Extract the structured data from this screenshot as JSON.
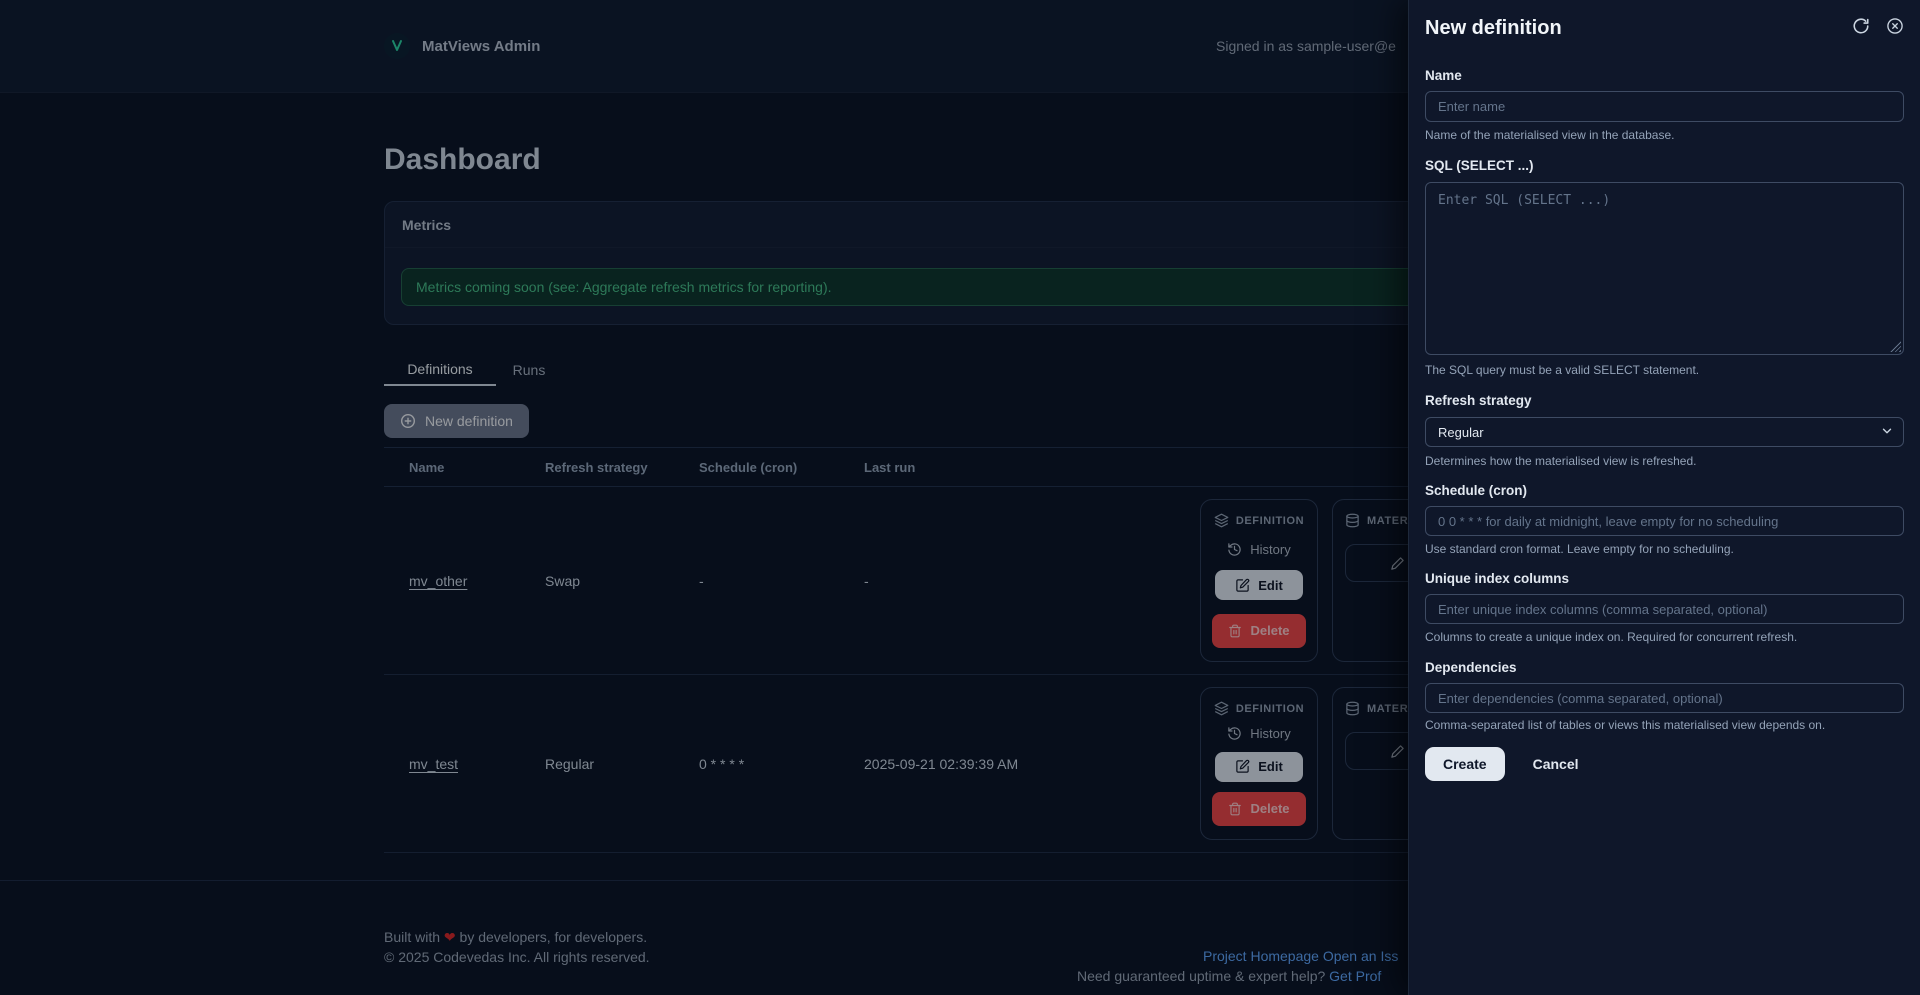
{
  "colors": {
    "accent_green": "#48be85",
    "link_blue": "#60a5fa",
    "danger_red": "#ef4444",
    "logo_teal": "#2dd4a0"
  },
  "header": {
    "app_title": "MatViews Admin",
    "signed_in": "Signed in as sample-user@e"
  },
  "page": {
    "title": "Dashboard"
  },
  "metrics": {
    "title": "Metrics",
    "notice": "Metrics coming soon (see: Aggregate refresh metrics for reporting)."
  },
  "tabs": {
    "definitions": "Definitions",
    "runs": "Runs"
  },
  "toolbar": {
    "new_definition": "New definition"
  },
  "table": {
    "columns": {
      "name": "Name",
      "refresh_strategy": "Refresh strategy",
      "schedule": "Schedule (cron)",
      "last_run": "Last run"
    },
    "rows": [
      {
        "name": "mv_other",
        "refresh_strategy": "Swap",
        "schedule": "-",
        "last_run": "-"
      },
      {
        "name": "mv_test",
        "refresh_strategy": "Regular",
        "schedule": "0 * * * *",
        "last_run": "2025-09-21 02:39:39 AM"
      }
    ],
    "actions": {
      "definition_label": "DEFINITION",
      "history": "History",
      "edit": "Edit",
      "delete": "Delete",
      "materialised_label": "MATER"
    }
  },
  "footer": {
    "built_prefix": "Built with",
    "heart": "❤",
    "built_suffix": "by developers, for developers.",
    "copyright": "© 2025 Codevedas Inc. All rights reserved.",
    "link_homepage": "Project Homepage",
    "link_issue": "Open an Iss",
    "support_text": "Need guaranteed uptime & expert help?",
    "support_link": "Get Prof"
  },
  "drawer": {
    "title": "New definition",
    "fields": {
      "name": {
        "label": "Name",
        "placeholder": "Enter name",
        "helper": "Name of the materialised view in the database."
      },
      "sql": {
        "label": "SQL (SELECT ...)",
        "placeholder": "Enter SQL (SELECT ...)",
        "helper": "The SQL query must be a valid SELECT statement."
      },
      "refresh_strategy": {
        "label": "Refresh strategy",
        "value": "Regular",
        "helper": "Determines how the materialised view is refreshed."
      },
      "schedule": {
        "label": "Schedule (cron)",
        "placeholder": "0 0 * * * for daily at midnight, leave empty for no scheduling",
        "helper": "Use standard cron format. Leave empty for no scheduling."
      },
      "unique_index": {
        "label": "Unique index columns",
        "placeholder": "Enter unique index columns (comma separated, optional)",
        "helper": "Columns to create a unique index on. Required for concurrent refresh."
      },
      "dependencies": {
        "label": "Dependencies",
        "placeholder": "Enter dependencies (comma separated, optional)",
        "helper": "Comma-separated list of tables or views this materialised view depends on."
      }
    },
    "buttons": {
      "create": "Create",
      "cancel": "Cancel"
    }
  }
}
